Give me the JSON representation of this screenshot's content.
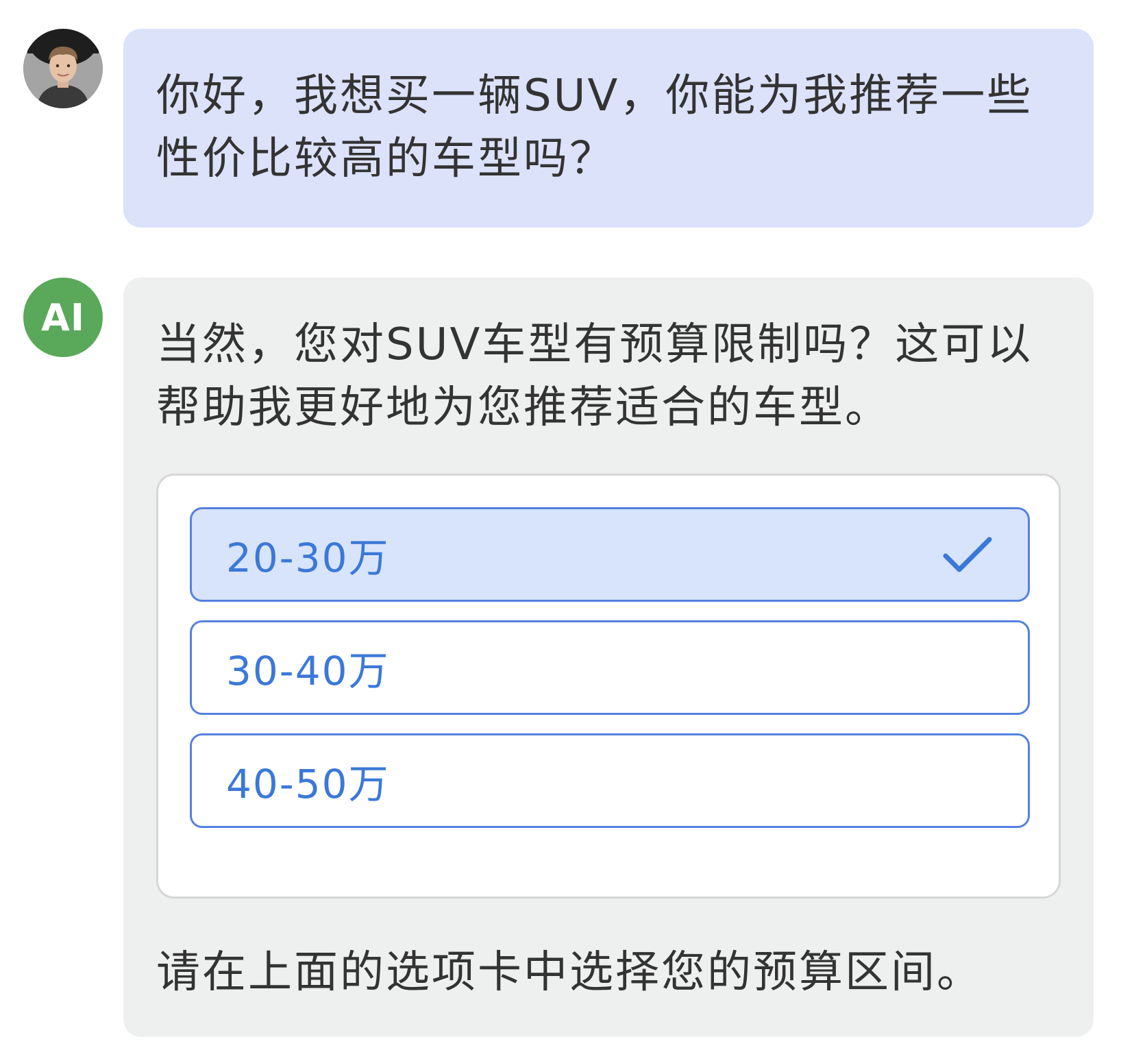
{
  "conversation": {
    "user": {
      "avatar_icon": "user-photo-avatar",
      "message": "你好，我想买一辆SUV，你能为我推荐一些性价比较高的车型吗？"
    },
    "ai": {
      "avatar_label": "AI",
      "avatar_color": "#5aa85a",
      "message": "当然，您对SUV车型有预算限制吗？这可以帮助我更好地为您推荐适合的车型。",
      "options": [
        {
          "label": "20-30万",
          "selected": true
        },
        {
          "label": "30-40万",
          "selected": false
        },
        {
          "label": "40-50万",
          "selected": false
        }
      ],
      "selected_icon": "check-icon",
      "footer": "请在上面的选项卡中选择您的预算区间。"
    }
  },
  "colors": {
    "user_bubble": "#dbe2fa",
    "ai_bubble": "#eeefef",
    "option_border": "#5580e0",
    "option_text": "#3b78d8",
    "option_selected_bg": "#d8e4fb"
  }
}
